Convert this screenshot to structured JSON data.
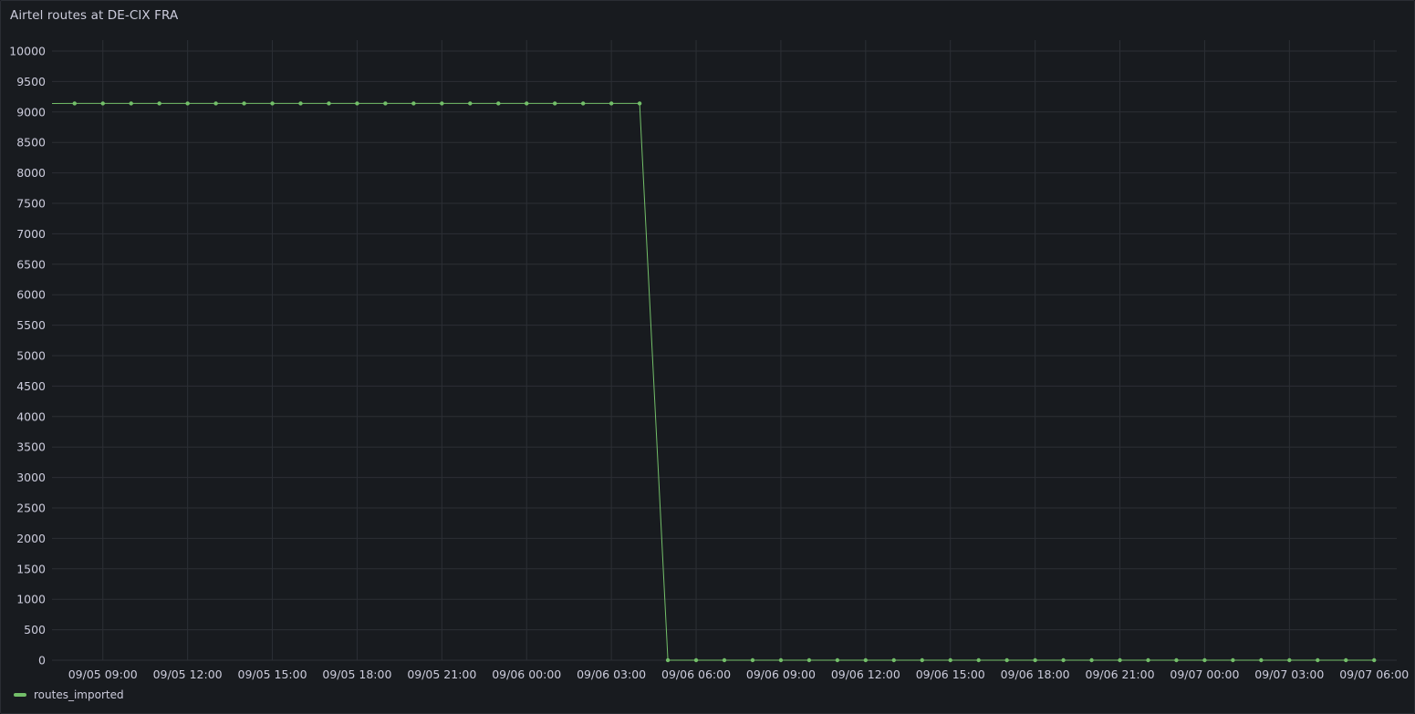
{
  "panel": {
    "title": "Airtel routes at DE-CIX FRA"
  },
  "legend": {
    "label": "routes_imported",
    "color": "#73bf69"
  },
  "chart_data": {
    "type": "line",
    "title": "Airtel routes at DE-CIX FRA",
    "xlabel": "",
    "ylabel": "",
    "ylim": [
      0,
      10000
    ],
    "yticks": [
      0,
      500,
      1000,
      1500,
      2000,
      2500,
      3000,
      3500,
      4000,
      4500,
      5000,
      5500,
      6000,
      6500,
      7000,
      7500,
      8000,
      8500,
      9000,
      9500,
      10000
    ],
    "xlim": [
      "09/05 07:12",
      "09/07 06:48"
    ],
    "xticks": [
      "09/05 09:00",
      "09/05 12:00",
      "09/05 15:00",
      "09/05 18:00",
      "09/05 21:00",
      "09/06 00:00",
      "09/06 03:00",
      "09/06 06:00",
      "09/06 09:00",
      "09/06 12:00",
      "09/06 15:00",
      "09/06 18:00",
      "09/06 21:00",
      "09/07 00:00",
      "09/07 03:00",
      "09/07 06:00"
    ],
    "grid": true,
    "legend_position": "bottom-left",
    "series": [
      {
        "name": "routes_imported",
        "color": "#73bf69",
        "points": [
          {
            "x": "09/05 08:00",
            "y": 9140
          },
          {
            "x": "09/05 09:00",
            "y": 9140
          },
          {
            "x": "09/05 10:00",
            "y": 9140
          },
          {
            "x": "09/05 11:00",
            "y": 9140
          },
          {
            "x": "09/05 12:00",
            "y": 9140
          },
          {
            "x": "09/05 13:00",
            "y": 9140
          },
          {
            "x": "09/05 14:00",
            "y": 9140
          },
          {
            "x": "09/05 15:00",
            "y": 9140
          },
          {
            "x": "09/05 16:00",
            "y": 9140
          },
          {
            "x": "09/05 17:00",
            "y": 9140
          },
          {
            "x": "09/05 18:00",
            "y": 9140
          },
          {
            "x": "09/05 19:00",
            "y": 9140
          },
          {
            "x": "09/05 20:00",
            "y": 9140
          },
          {
            "x": "09/05 21:00",
            "y": 9140
          },
          {
            "x": "09/05 22:00",
            "y": 9140
          },
          {
            "x": "09/05 23:00",
            "y": 9140
          },
          {
            "x": "09/06 00:00",
            "y": 9140
          },
          {
            "x": "09/06 01:00",
            "y": 9140
          },
          {
            "x": "09/06 02:00",
            "y": 9140
          },
          {
            "x": "09/06 03:00",
            "y": 9140
          },
          {
            "x": "09/06 04:00",
            "y": 9140
          },
          {
            "x": "09/06 05:00",
            "y": 0
          },
          {
            "x": "09/06 06:00",
            "y": 0
          },
          {
            "x": "09/06 07:00",
            "y": 0
          },
          {
            "x": "09/06 08:00",
            "y": 0
          },
          {
            "x": "09/06 09:00",
            "y": 0
          },
          {
            "x": "09/06 10:00",
            "y": 0
          },
          {
            "x": "09/06 11:00",
            "y": 0
          },
          {
            "x": "09/06 12:00",
            "y": 0
          },
          {
            "x": "09/06 13:00",
            "y": 0
          },
          {
            "x": "09/06 14:00",
            "y": 0
          },
          {
            "x": "09/06 15:00",
            "y": 0
          },
          {
            "x": "09/06 16:00",
            "y": 0
          },
          {
            "x": "09/06 17:00",
            "y": 0
          },
          {
            "x": "09/06 18:00",
            "y": 0
          },
          {
            "x": "09/06 19:00",
            "y": 0
          },
          {
            "x": "09/06 20:00",
            "y": 0
          },
          {
            "x": "09/06 21:00",
            "y": 0
          },
          {
            "x": "09/06 22:00",
            "y": 0
          },
          {
            "x": "09/06 23:00",
            "y": 0
          },
          {
            "x": "09/07 00:00",
            "y": 0
          },
          {
            "x": "09/07 01:00",
            "y": 0
          },
          {
            "x": "09/07 02:00",
            "y": 0
          },
          {
            "x": "09/07 03:00",
            "y": 0
          },
          {
            "x": "09/07 04:00",
            "y": 0
          },
          {
            "x": "09/07 05:00",
            "y": 0
          },
          {
            "x": "09/07 06:00",
            "y": 0
          }
        ]
      }
    ]
  }
}
